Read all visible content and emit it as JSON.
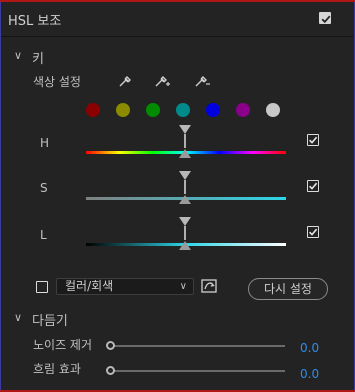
{
  "panel": {
    "title": "HSL 보조",
    "enabled": true
  },
  "key_section": {
    "label": "키",
    "color_setting_label": "색상 설정",
    "swatches": [
      "#8b0000",
      "#8b8b00",
      "#008b00",
      "#008b8b",
      "#0000e0",
      "#8b008b",
      "#c8c8c8"
    ],
    "channels": [
      {
        "label": "H",
        "checked": true
      },
      {
        "label": "S",
        "checked": true
      },
      {
        "label": "L",
        "checked": true
      }
    ]
  },
  "display": {
    "mode_select_value": "컬러/회색",
    "reset_label": "다시 설정",
    "show_checked": false
  },
  "refine_section": {
    "label": "다듬기",
    "rows": [
      {
        "label": "노이즈 제거",
        "value": "0.0",
        "level": 0
      },
      {
        "label": "흐림 효과",
        "value": "0.0",
        "level": 0
      }
    ]
  },
  "colors": {
    "accent_value": "#2d8ceb",
    "border_red": "#b01818"
  }
}
